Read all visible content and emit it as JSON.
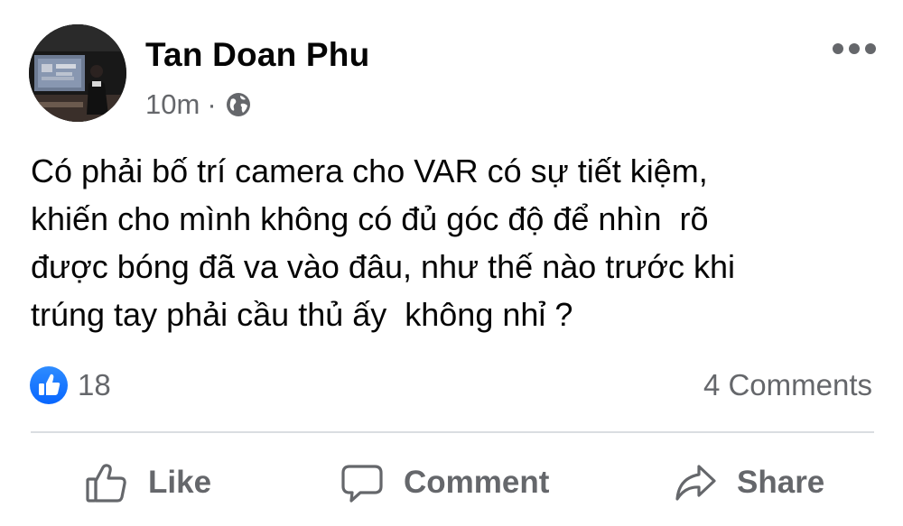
{
  "post": {
    "author": "Tan Doan Phu",
    "time": "10m",
    "separator": "·",
    "audience_icon": "globe-icon",
    "text": "Có phải bố trí camera cho VAR có sự tiết kiệm,\nkhiến cho mình không có đủ góc độ để nhìn  rõ\nđược bóng đã va vào đâu, như thế nào trước khi\ntrúng tay phải cầu thủ ấy  không nhỉ ?"
  },
  "reactions": {
    "icon": "like-reaction-icon",
    "count": "18"
  },
  "comments": {
    "label": "4 Comments"
  },
  "actions": {
    "like_label": "Like",
    "comment_label": "Comment",
    "share_label": "Share"
  },
  "colors": {
    "text_primary": "#050505",
    "text_secondary": "#65676b",
    "like_blue": "#1877f2",
    "divider": "#dadde1"
  }
}
